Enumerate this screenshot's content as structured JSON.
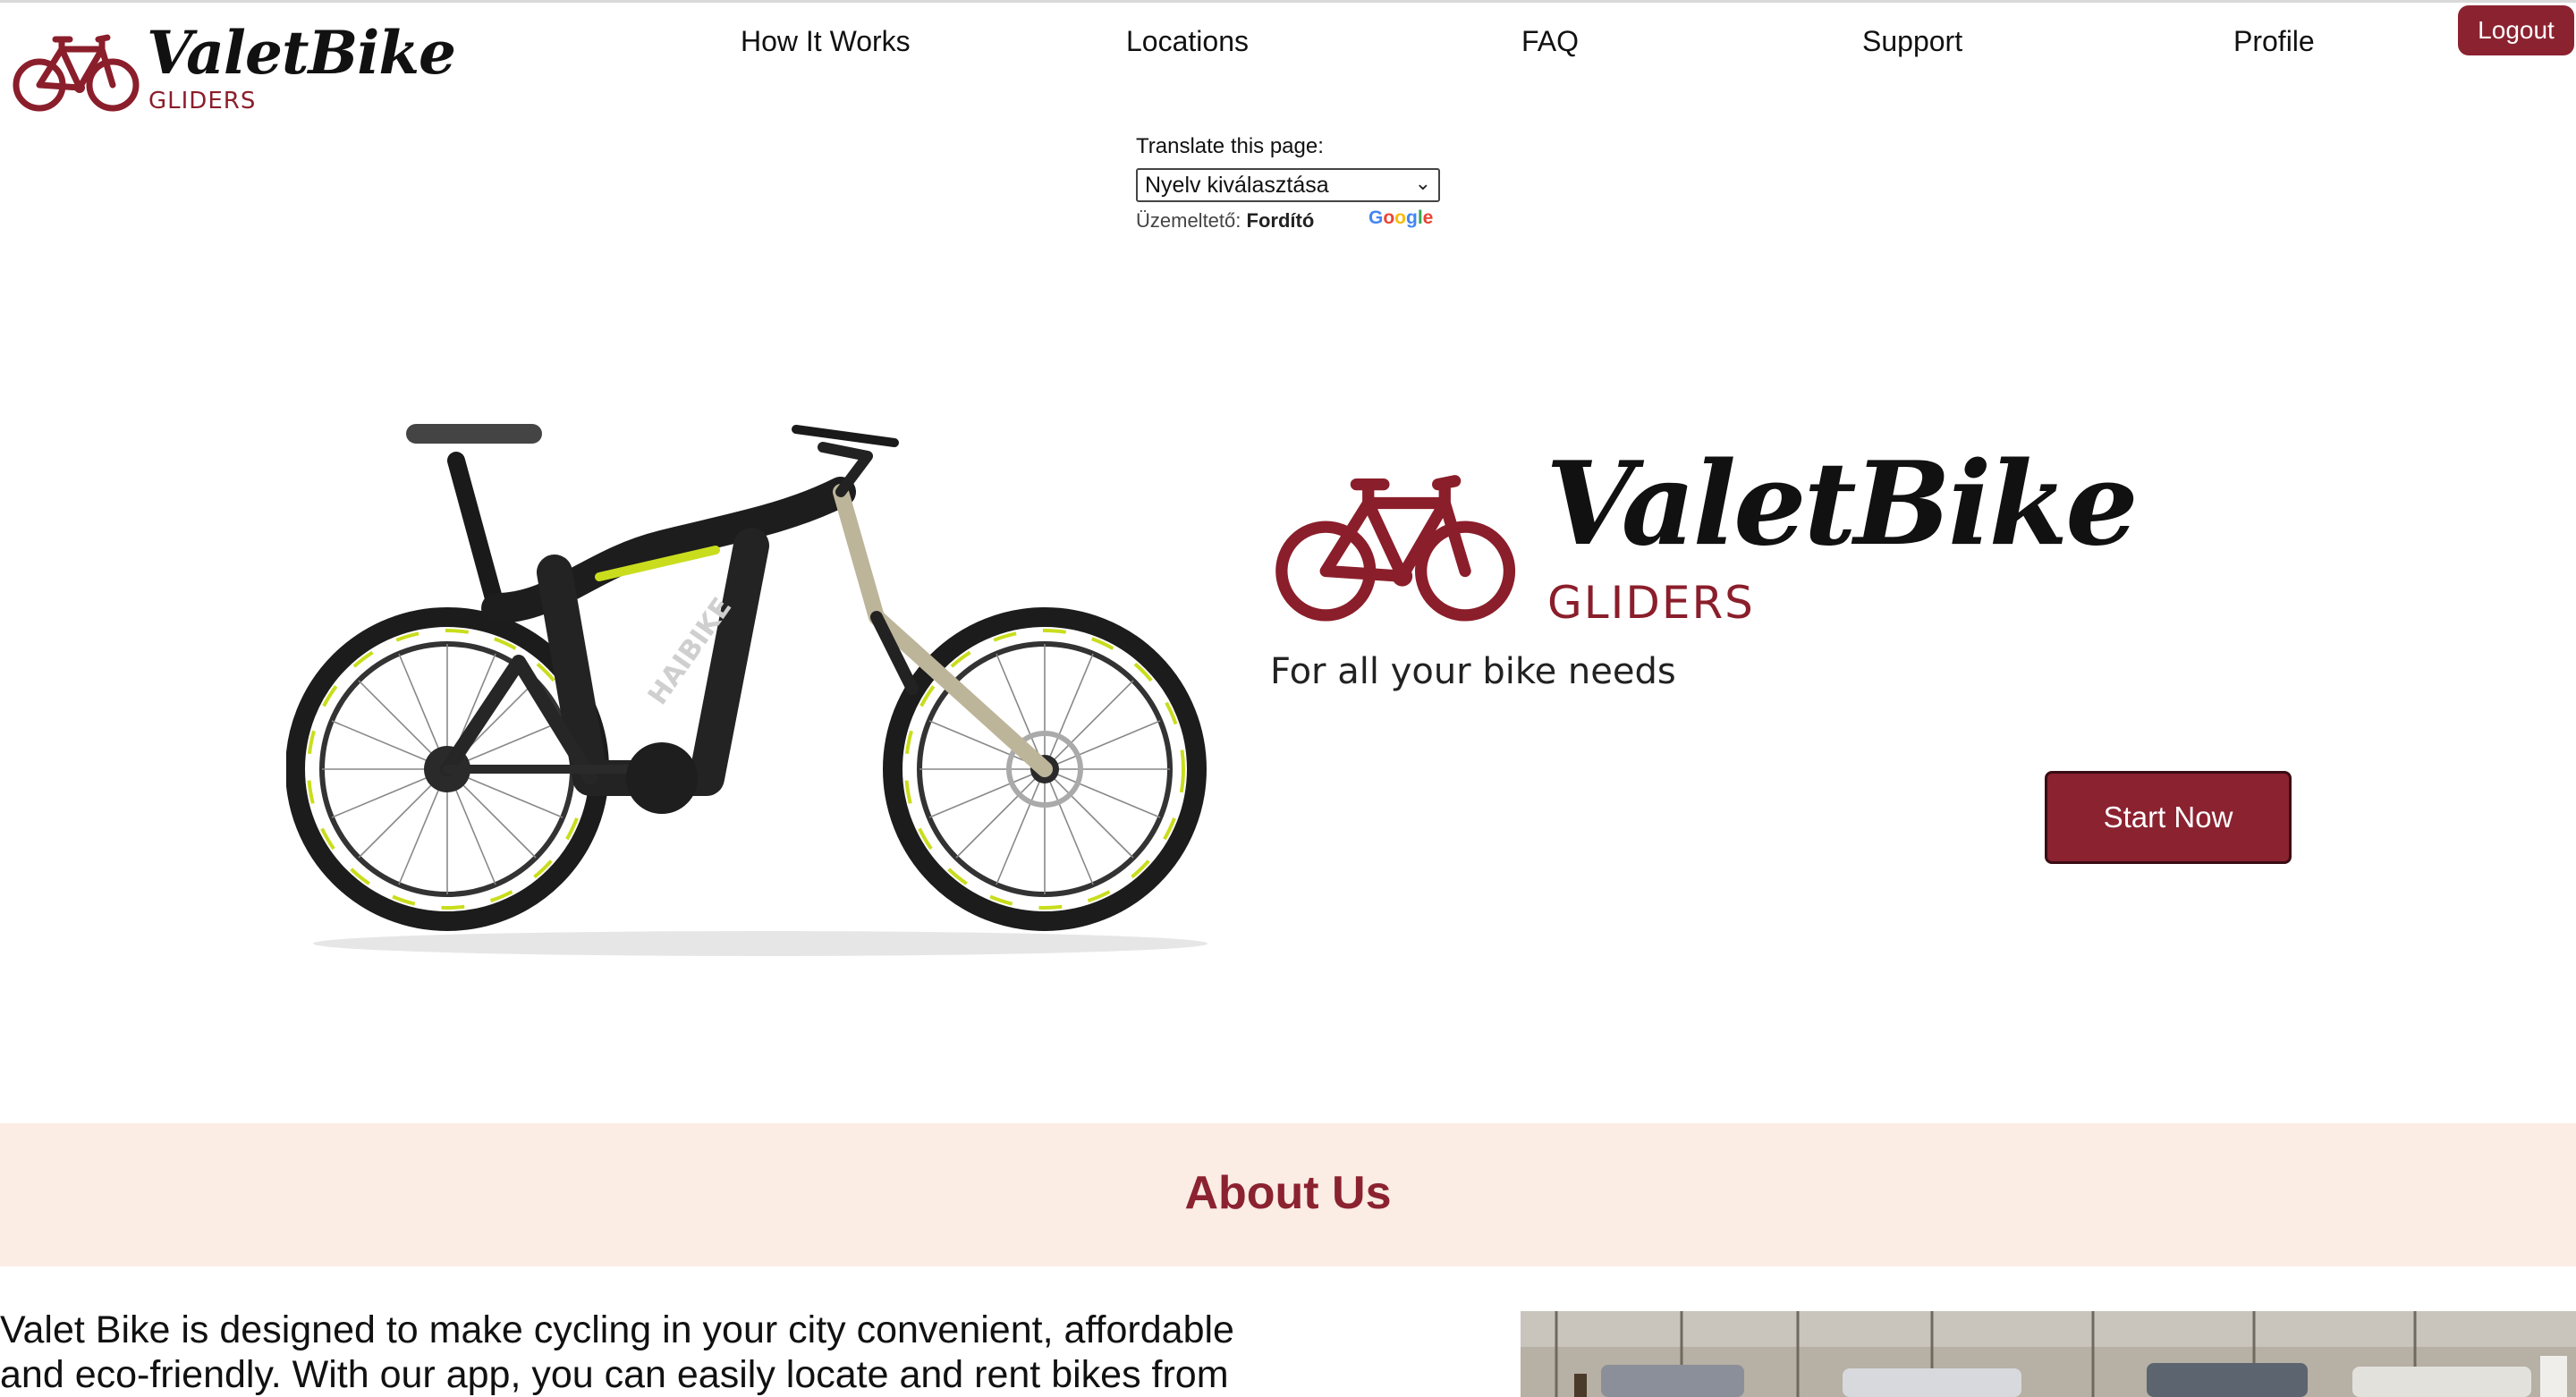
{
  "header": {
    "logo": {
      "wordmark": "ValetBike",
      "sub": "GLIDERS"
    },
    "nav": [
      {
        "label": "How It Works"
      },
      {
        "label": "Locations"
      },
      {
        "label": "FAQ"
      },
      {
        "label": "Support"
      },
      {
        "label": "Profile"
      }
    ],
    "logout_label": "Logout"
  },
  "translate": {
    "label": "Translate this page:",
    "selected": "Nyelv kiválasztása",
    "powered_prefix": "Üzemeltető:",
    "powered_name": "Fordító",
    "google": "Google"
  },
  "hero": {
    "logo": {
      "wordmark": "ValetBike",
      "sub": "GLIDERS"
    },
    "tagline": "For all your bike needs",
    "cta_label": "Start Now"
  },
  "about": {
    "title": "About Us",
    "text": "Valet Bike is designed to make cycling in your city convenient, affordable and eco-friendly. With our app, you can easily locate and rent bikes from"
  },
  "colors": {
    "brand": "#8b2230",
    "band": "#fbece4"
  }
}
